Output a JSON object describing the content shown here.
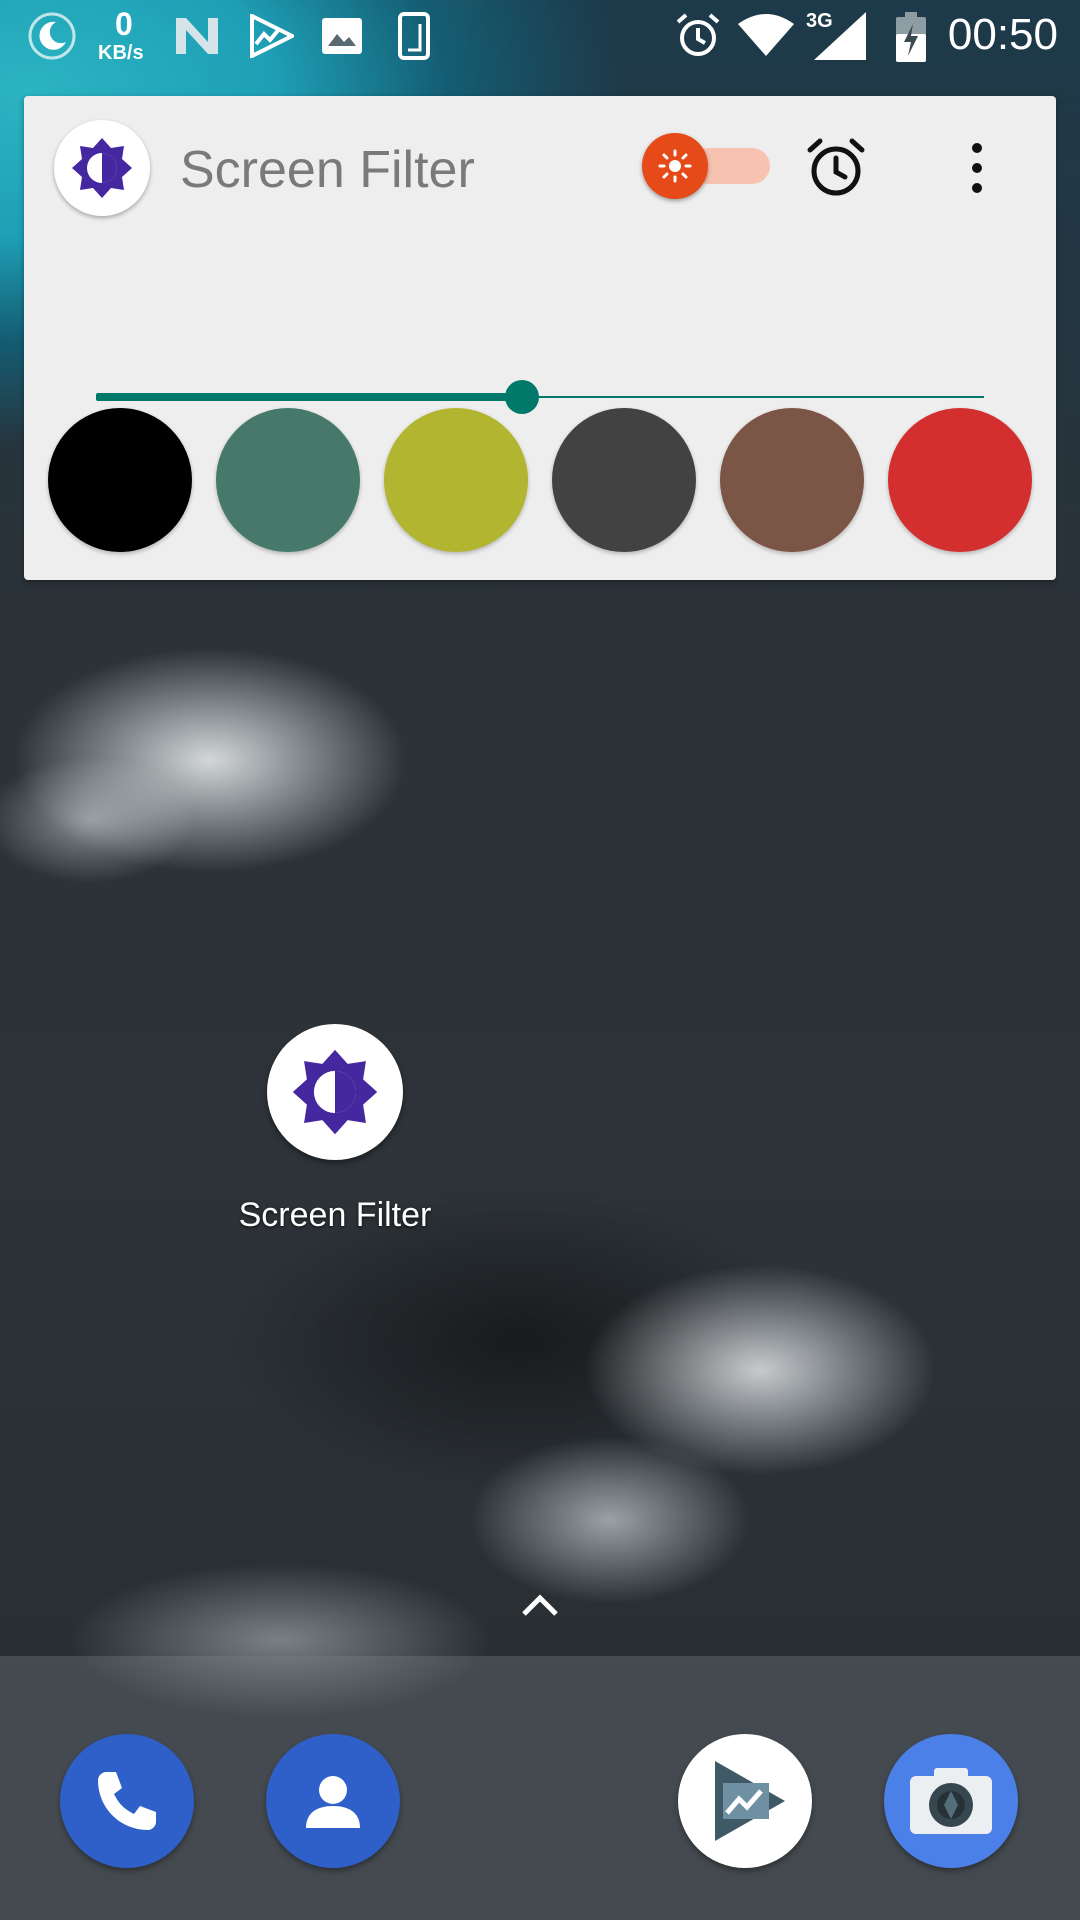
{
  "status_bar": {
    "network_speed_value": "0",
    "network_speed_unit": "KB/s",
    "network_type": "3G",
    "time": "00:50",
    "icons": [
      "night-mode-icon",
      "n-icon",
      "play-movies-icon",
      "image-icon",
      "screenshot-icon",
      "alarm-icon",
      "wifi-icon",
      "signal-icon",
      "battery-charging-icon"
    ]
  },
  "widget": {
    "title": "Screen Filter",
    "toggle_on": true,
    "brightness_level": 0.48,
    "swatch_colors": [
      "#000000",
      "#46796a",
      "#b1b530",
      "#424242",
      "#7b5545",
      "#d32f2f"
    ],
    "accent": "#00796b",
    "toggle_color": "#e64a19"
  },
  "home": {
    "app_label": "Screen Filter"
  },
  "dock": {
    "apps": [
      "phone-icon",
      "contacts-icon",
      "play-movies-icon",
      "camera-icon"
    ]
  }
}
